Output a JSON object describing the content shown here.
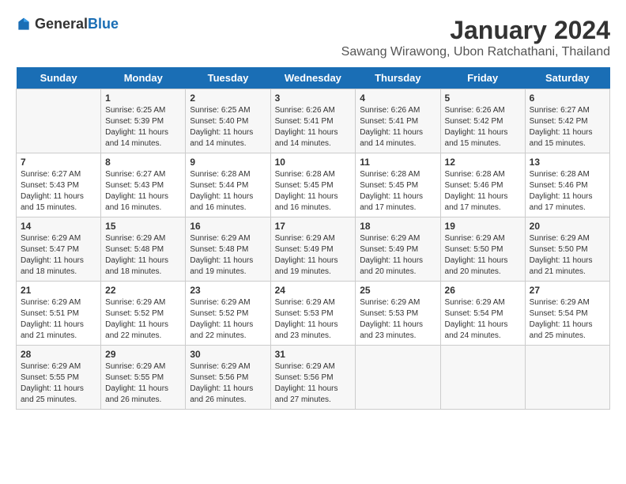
{
  "header": {
    "logo_general": "General",
    "logo_blue": "Blue",
    "main_title": "January 2024",
    "subtitle": "Sawang Wirawong, Ubon Ratchathani, Thailand"
  },
  "days_of_week": [
    "Sunday",
    "Monday",
    "Tuesday",
    "Wednesday",
    "Thursday",
    "Friday",
    "Saturday"
  ],
  "weeks": [
    {
      "cells": [
        {
          "date": "",
          "info": ""
        },
        {
          "date": "1",
          "info": "Sunrise: 6:25 AM\nSunset: 5:39 PM\nDaylight: 11 hours and 14 minutes."
        },
        {
          "date": "2",
          "info": "Sunrise: 6:25 AM\nSunset: 5:40 PM\nDaylight: 11 hours and 14 minutes."
        },
        {
          "date": "3",
          "info": "Sunrise: 6:26 AM\nSunset: 5:41 PM\nDaylight: 11 hours and 14 minutes."
        },
        {
          "date": "4",
          "info": "Sunrise: 6:26 AM\nSunset: 5:41 PM\nDaylight: 11 hours and 14 minutes."
        },
        {
          "date": "5",
          "info": "Sunrise: 6:26 AM\nSunset: 5:42 PM\nDaylight: 11 hours and 15 minutes."
        },
        {
          "date": "6",
          "info": "Sunrise: 6:27 AM\nSunset: 5:42 PM\nDaylight: 11 hours and 15 minutes."
        }
      ]
    },
    {
      "cells": [
        {
          "date": "7",
          "info": "Sunrise: 6:27 AM\nSunset: 5:43 PM\nDaylight: 11 hours and 15 minutes."
        },
        {
          "date": "8",
          "info": "Sunrise: 6:27 AM\nSunset: 5:43 PM\nDaylight: 11 hours and 16 minutes."
        },
        {
          "date": "9",
          "info": "Sunrise: 6:28 AM\nSunset: 5:44 PM\nDaylight: 11 hours and 16 minutes."
        },
        {
          "date": "10",
          "info": "Sunrise: 6:28 AM\nSunset: 5:45 PM\nDaylight: 11 hours and 16 minutes."
        },
        {
          "date": "11",
          "info": "Sunrise: 6:28 AM\nSunset: 5:45 PM\nDaylight: 11 hours and 17 minutes."
        },
        {
          "date": "12",
          "info": "Sunrise: 6:28 AM\nSunset: 5:46 PM\nDaylight: 11 hours and 17 minutes."
        },
        {
          "date": "13",
          "info": "Sunrise: 6:28 AM\nSunset: 5:46 PM\nDaylight: 11 hours and 17 minutes."
        }
      ]
    },
    {
      "cells": [
        {
          "date": "14",
          "info": "Sunrise: 6:29 AM\nSunset: 5:47 PM\nDaylight: 11 hours and 18 minutes."
        },
        {
          "date": "15",
          "info": "Sunrise: 6:29 AM\nSunset: 5:48 PM\nDaylight: 11 hours and 18 minutes."
        },
        {
          "date": "16",
          "info": "Sunrise: 6:29 AM\nSunset: 5:48 PM\nDaylight: 11 hours and 19 minutes."
        },
        {
          "date": "17",
          "info": "Sunrise: 6:29 AM\nSunset: 5:49 PM\nDaylight: 11 hours and 19 minutes."
        },
        {
          "date": "18",
          "info": "Sunrise: 6:29 AM\nSunset: 5:49 PM\nDaylight: 11 hours and 20 minutes."
        },
        {
          "date": "19",
          "info": "Sunrise: 6:29 AM\nSunset: 5:50 PM\nDaylight: 11 hours and 20 minutes."
        },
        {
          "date": "20",
          "info": "Sunrise: 6:29 AM\nSunset: 5:50 PM\nDaylight: 11 hours and 21 minutes."
        }
      ]
    },
    {
      "cells": [
        {
          "date": "21",
          "info": "Sunrise: 6:29 AM\nSunset: 5:51 PM\nDaylight: 11 hours and 21 minutes."
        },
        {
          "date": "22",
          "info": "Sunrise: 6:29 AM\nSunset: 5:52 PM\nDaylight: 11 hours and 22 minutes."
        },
        {
          "date": "23",
          "info": "Sunrise: 6:29 AM\nSunset: 5:52 PM\nDaylight: 11 hours and 22 minutes."
        },
        {
          "date": "24",
          "info": "Sunrise: 6:29 AM\nSunset: 5:53 PM\nDaylight: 11 hours and 23 minutes."
        },
        {
          "date": "25",
          "info": "Sunrise: 6:29 AM\nSunset: 5:53 PM\nDaylight: 11 hours and 23 minutes."
        },
        {
          "date": "26",
          "info": "Sunrise: 6:29 AM\nSunset: 5:54 PM\nDaylight: 11 hours and 24 minutes."
        },
        {
          "date": "27",
          "info": "Sunrise: 6:29 AM\nSunset: 5:54 PM\nDaylight: 11 hours and 25 minutes."
        }
      ]
    },
    {
      "cells": [
        {
          "date": "28",
          "info": "Sunrise: 6:29 AM\nSunset: 5:55 PM\nDaylight: 11 hours and 25 minutes."
        },
        {
          "date": "29",
          "info": "Sunrise: 6:29 AM\nSunset: 5:55 PM\nDaylight: 11 hours and 26 minutes."
        },
        {
          "date": "30",
          "info": "Sunrise: 6:29 AM\nSunset: 5:56 PM\nDaylight: 11 hours and 26 minutes."
        },
        {
          "date": "31",
          "info": "Sunrise: 6:29 AM\nSunset: 5:56 PM\nDaylight: 11 hours and 27 minutes."
        },
        {
          "date": "",
          "info": ""
        },
        {
          "date": "",
          "info": ""
        },
        {
          "date": "",
          "info": ""
        }
      ]
    }
  ]
}
